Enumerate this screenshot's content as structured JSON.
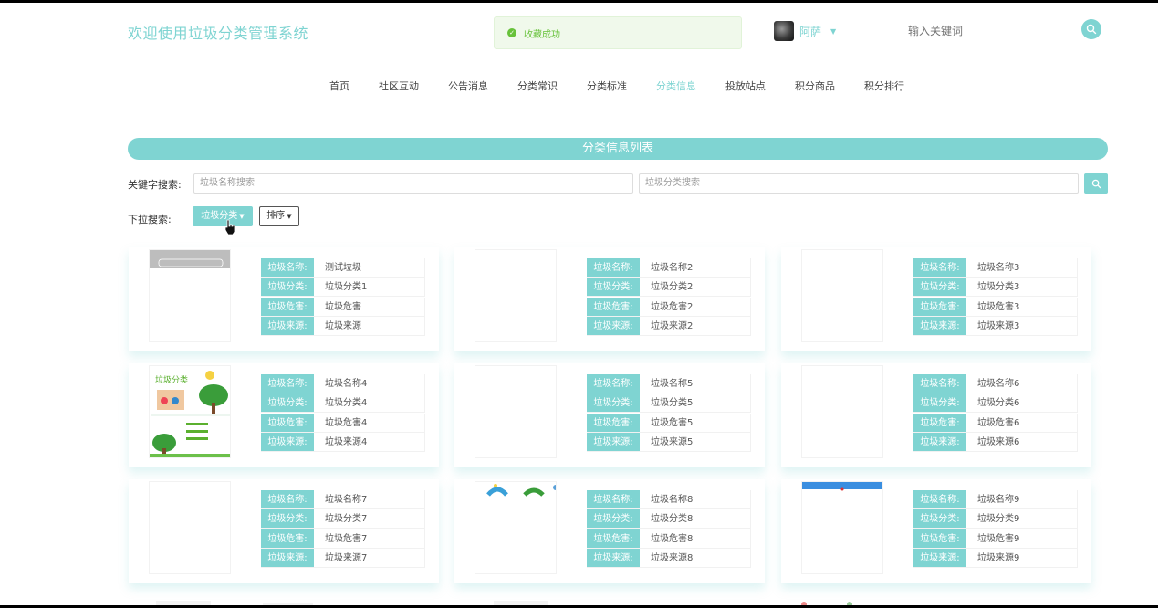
{
  "header": {
    "site_title": "欢迎使用垃圾分类管理系统",
    "toast": "收藏成功",
    "user_name": "阿萨",
    "search_placeholder": "输入关键词"
  },
  "nav": {
    "items": [
      {
        "label": "首页"
      },
      {
        "label": "社区互动"
      },
      {
        "label": "公告消息"
      },
      {
        "label": "分类常识"
      },
      {
        "label": "分类标准"
      },
      {
        "label": "分类信息",
        "active": true
      },
      {
        "label": "投放站点"
      },
      {
        "label": "积分商品"
      },
      {
        "label": "积分排行"
      }
    ]
  },
  "list": {
    "banner_title": "分类信息列表",
    "keyword_label": "关键字搜索:",
    "name_placeholder": "垃圾名称搜索",
    "category_placeholder": "垃圾分类搜索",
    "dropdown_label": "下拉搜索:",
    "category_dropdown": "垃圾分类",
    "sort_dropdown": "排序"
  },
  "labels": {
    "name": "垃圾名称:",
    "category": "垃圾分类:",
    "hazard": "垃圾危害:",
    "source": "垃圾来源:"
  },
  "items": [
    {
      "name": "测试垃圾",
      "category": "垃圾分类1",
      "hazard": "垃圾危害",
      "source": "垃圾来源",
      "thumb": "gray-banner"
    },
    {
      "name": "垃圾名称2",
      "category": "垃圾分类2",
      "hazard": "垃圾危害2",
      "source": "垃圾来源2",
      "thumb": "blank"
    },
    {
      "name": "垃圾名称3",
      "category": "垃圾分类3",
      "hazard": "垃圾危害3",
      "source": "垃圾来源3",
      "thumb": "blank"
    },
    {
      "name": "垃圾名称4",
      "category": "垃圾分类4",
      "hazard": "垃圾危害4",
      "source": "垃圾来源4",
      "thumb": "poster",
      "thumb_text": "垃圾分类"
    },
    {
      "name": "垃圾名称5",
      "category": "垃圾分类5",
      "hazard": "垃圾危害5",
      "source": "垃圾来源5",
      "thumb": "blank"
    },
    {
      "name": "垃圾名称6",
      "category": "垃圾分类6",
      "hazard": "垃圾危害6",
      "source": "垃圾来源6",
      "thumb": "blank"
    },
    {
      "name": "垃圾名称7",
      "category": "垃圾分类7",
      "hazard": "垃圾危害7",
      "source": "垃圾来源7",
      "thumb": "blank"
    },
    {
      "name": "垃圾名称8",
      "category": "垃圾分类8",
      "hazard": "垃圾危害8",
      "source": "垃圾来源8",
      "thumb": "bins"
    },
    {
      "name": "垃圾名称9",
      "category": "垃圾分类9",
      "hazard": "垃圾危害9",
      "source": "垃圾来源9",
      "thumb": "blue-bar"
    }
  ],
  "colors": {
    "accent": "#7fd4d2",
    "toast_bg": "#f0f9eb",
    "toast_text": "#67c23a"
  }
}
